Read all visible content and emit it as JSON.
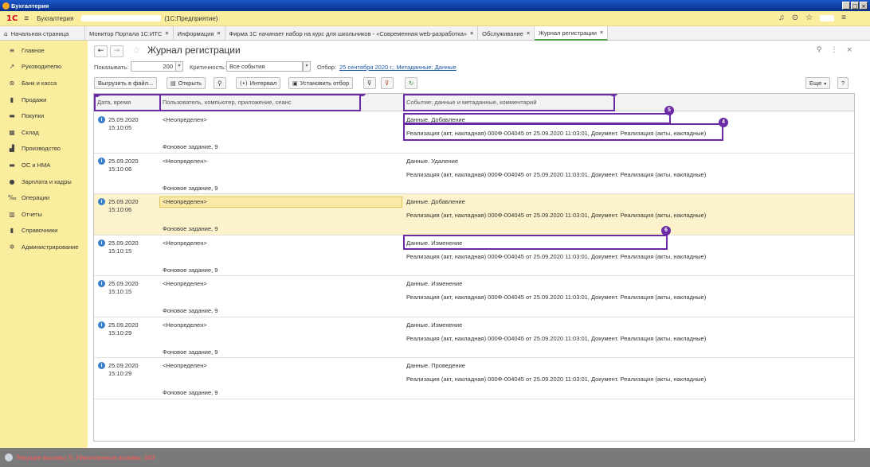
{
  "window": {
    "title": "Бухгалтерия",
    "controls": [
      "_",
      "□",
      "×"
    ]
  },
  "header": {
    "logo": "1С",
    "app_name": "Бухгалтерия",
    "platform": "(1С:Предприятие)",
    "icons": [
      "bell-icon",
      "history-icon",
      "star-icon",
      "settings-icon"
    ]
  },
  "tabs": [
    {
      "label": "Начальная страница"
    },
    {
      "label": "Монитор Портала 1С:ИТС",
      "close": "×"
    },
    {
      "label": "Информация",
      "close": "×"
    },
    {
      "label": "Фирма 1С начинает набор на курс для школьников - «Современная web-разработка»",
      "close": "×"
    },
    {
      "label": "Обслуживание",
      "close": "×"
    },
    {
      "label": "Журнал регистрации",
      "close": "×"
    }
  ],
  "sidebar": {
    "items": [
      {
        "label": "Главное",
        "icon": "≡"
      },
      {
        "label": "Руководителю",
        "icon": "↗"
      },
      {
        "label": "Банк и касса",
        "icon": "⊛"
      },
      {
        "label": "Продажи",
        "icon": "▮"
      },
      {
        "label": "Покупки",
        "icon": "▬"
      },
      {
        "label": "Склад",
        "icon": "▦"
      },
      {
        "label": "Производство",
        "icon": "▟"
      },
      {
        "label": "ОС и НМА",
        "icon": "▬"
      },
      {
        "label": "Зарплата и кадры",
        "icon": "●"
      },
      {
        "label": "Операции",
        "icon": "‰"
      },
      {
        "label": "Отчеты",
        "icon": "▥"
      },
      {
        "label": "Справочники",
        "icon": "▮"
      },
      {
        "label": "Администрирование",
        "icon": "✲"
      }
    ]
  },
  "form": {
    "title": "Журнал регистрации",
    "show_label": "Показывать:",
    "show_value": "200",
    "crit_label": "Критичность:",
    "crit_value": "Все события",
    "filter_label": "Отбор:",
    "filter_link": "25 сентября 2020 г.; Метаданные: Данные",
    "toolbar": {
      "export": "Выгрузить в файл...",
      "open": "Открыть",
      "interval": "Интервал",
      "set_filter": "Установить отбор",
      "more": "Еще",
      "help": "?"
    }
  },
  "table": {
    "columns": [
      "Дата, время",
      "Пользователь, компьютер, приложение, сеанс",
      "Событие; данные и метаданные, комментарий"
    ],
    "rows": [
      {
        "date": "25.09.2020",
        "time": "15:10:05",
        "user": "<Неопределен>",
        "session": "Фоновое задание, 9",
        "event": "Данные. Добавление",
        "data": "Реализация (акт, накладная) 000Ф-004045 от 25.09.2020 11:03:01, Документ. Реализация (акты, накладные)"
      },
      {
        "date": "25.09.2020",
        "time": "15:10:06",
        "user": "<Неопределен>",
        "session": "Фоновое задание, 9",
        "event": "Данные. Удаление",
        "data": "Реализация (акт, накладная) 000Ф-004045 от 25.09.2020 11:03:01, Документ. Реализация (акты, накладные)"
      },
      {
        "date": "25.09.2020",
        "time": "15:10:06",
        "user": "<Неопределен>",
        "session": "Фоновое задание, 9",
        "event": "Данные. Добавление",
        "data": "Реализация (акт, накладная) 000Ф-004045 от 25.09.2020 11:03:01, Документ. Реализация (акты, накладные)"
      },
      {
        "date": "25.09.2020",
        "time": "15:10:15",
        "user": "<Неопределен>",
        "session": "Фоновое задание, 9",
        "event": "Данные. Изменение",
        "data": "Реализация (акт, накладная) 000Ф-004045 от 25.09.2020 11:03:01, Документ. Реализация (акты, накладные)"
      },
      {
        "date": "25.09.2020",
        "time": "15:10:15",
        "user": "<Неопределен>",
        "session": "Фоновое задание, 9",
        "event": "Данные. Изменение",
        "data": "Реализация (акт, накладная) 000Ф-004045 от 25.09.2020 11:03:01, Документ. Реализация (акты, накладные)"
      },
      {
        "date": "25.09.2020",
        "time": "15:10:29",
        "user": "<Неопределен>",
        "session": "Фоновое задание, 9",
        "event": "Данные. Изменение",
        "data": "Реализация (акт, накладная) 000Ф-004045 от 25.09.2020 11:03:01, Документ. Реализация (акты, накладные)"
      },
      {
        "date": "25.09.2020",
        "time": "15:10:29",
        "user": "<Неопределен>",
        "session": "Фоновое задание, 9",
        "event": "Данные. Проведение",
        "data": "Реализация (акт, накладная) 000Ф-004045 от 25.09.2020 11:03:01, Документ. Реализация (акты, накладные)"
      }
    ]
  },
  "annotations": [
    "1",
    "2",
    "3",
    "4",
    "5",
    "6"
  ],
  "status": {
    "text": "Текущие вызовы: 5.   Накопленные вызовы: 463"
  },
  "colors": {
    "accent_yellow": "#fbed9e",
    "annotation_purple": "#6a2aa5",
    "link_blue": "#1c59a8",
    "status_red": "#ff5a5a"
  }
}
